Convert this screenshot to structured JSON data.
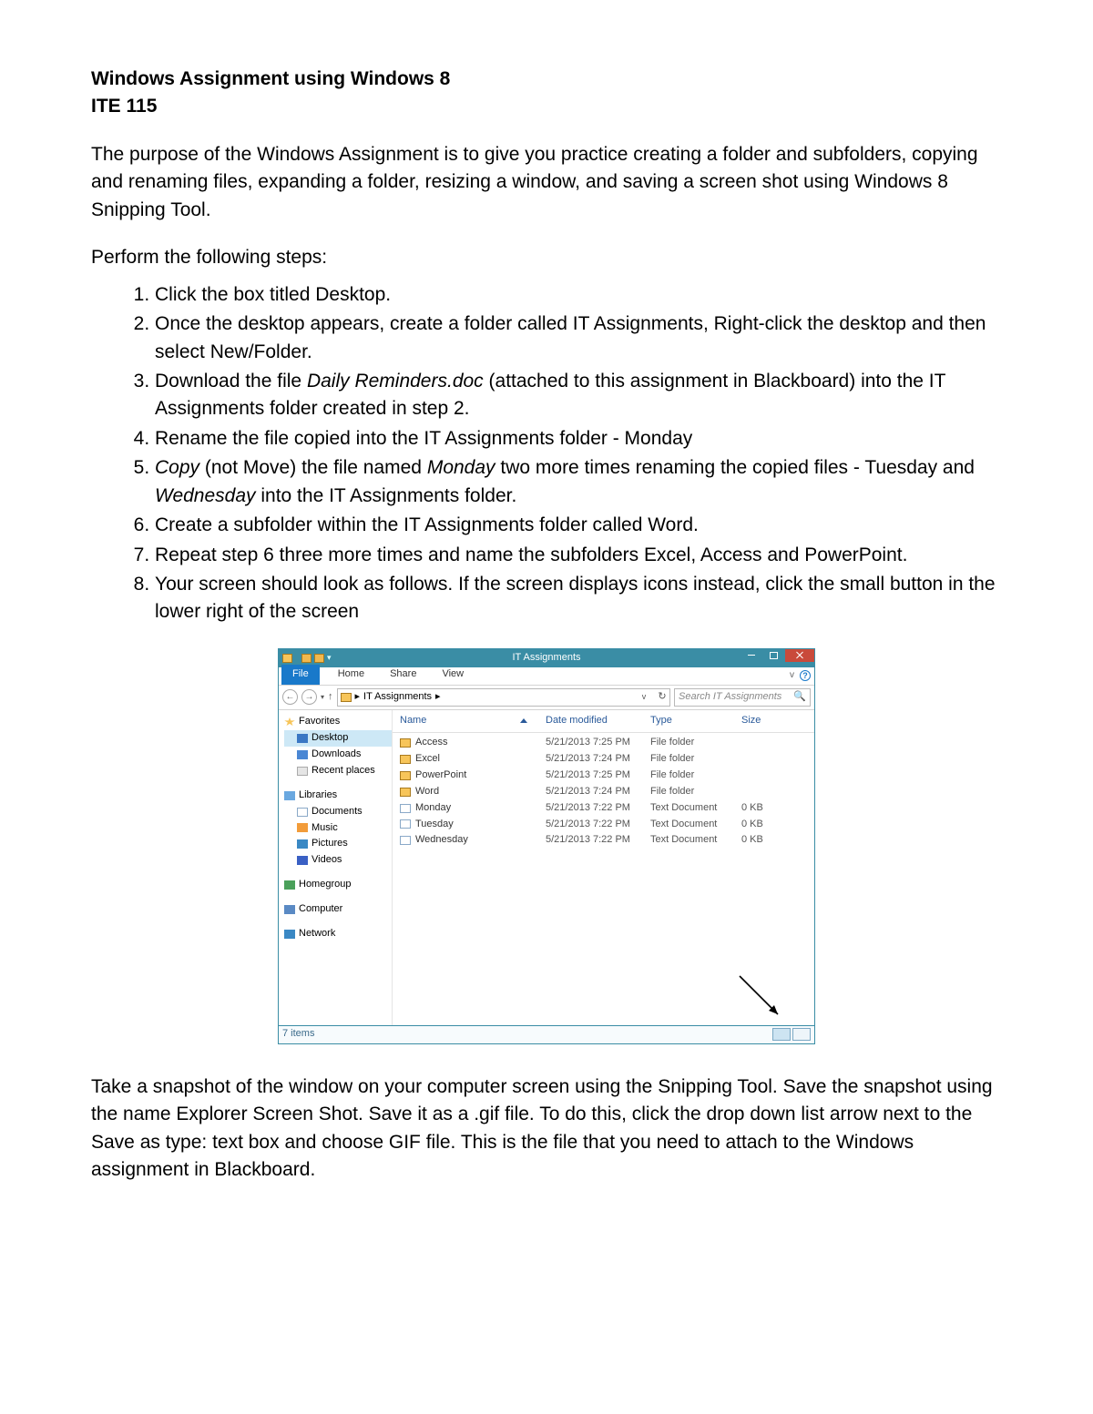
{
  "title1": "Windows Assignment using Windows 8",
  "title2": "ITE 115",
  "intro": "The purpose of the Windows Assignment is to give you practice creating a folder and subfolders, copying and renaming files, expanding a folder, resizing a window, and saving a screen shot using Windows 8 Snipping Tool.",
  "performText": "Perform the following steps:",
  "steps": {
    "s1": "Click the box titled Desktop.",
    "s2": "Once the desktop appears, create a folder called IT Assignments, Right-click the desktop and then select New/Folder.",
    "s3a": "Download the file ",
    "s3file": "Daily Reminders.doc",
    "s3b": " (attached to this assignment in Blackboard) into the IT Assignments folder created in step 2.",
    "s4": "Rename the file copied into the IT Assignments folder - Monday",
    "s5a": "Copy",
    "s5b": " (not Move) the file named ",
    "s5c": "Monday",
    "s5d": " two more times renaming the copied files - Tuesday and ",
    "s5e": "Wednesday",
    "s5f": " into the IT Assignments folder.",
    "s6": "Create a subfolder within the IT Assignments folder called Word.",
    "s7": "Repeat step 6 three more times and name the subfolders Excel, Access and PowerPoint.",
    "s8": "Your screen should look as follows.  If the screen displays icons instead, click the small button in the lower right of the screen"
  },
  "outro": "Take a snapshot of the window on your computer screen using the Snipping Tool.  Save the snapshot using the name Explorer Screen Shot.  Save it as a .gif file.  To do this, click the drop down list arrow next to the Save as type: text box and choose GIF file.  This is the file that you need to attach to the Windows assignment in Blackboard.",
  "explorer": {
    "windowTitle": "IT Assignments",
    "tabs": {
      "file": "File",
      "home": "Home",
      "share": "Share",
      "view": "View"
    },
    "breadcrumb": {
      "arrow1": "▸",
      "folder": "IT Assignments",
      "arrow2": "▸"
    },
    "refreshLabel": "↻",
    "dropdownLabel": "v",
    "searchPlaceholder": "Search IT Assignments",
    "navArrows": {
      "back": "←",
      "fwd": "→",
      "down": "▾",
      "up": "↑"
    },
    "nav": {
      "favorites": "Favorites",
      "desktop": "Desktop",
      "downloads": "Downloads",
      "recent": "Recent places",
      "libraries": "Libraries",
      "documents": "Documents",
      "music": "Music",
      "pictures": "Pictures",
      "videos": "Videos",
      "homegroup": "Homegroup",
      "computer": "Computer",
      "network": "Network"
    },
    "cols": {
      "name": "Name",
      "date": "Date modified",
      "type": "Type",
      "size": "Size"
    },
    "rows": [
      {
        "icon": "fold",
        "name": "Access",
        "date": "5/21/2013 7:25 PM",
        "type": "File folder",
        "size": ""
      },
      {
        "icon": "fold",
        "name": "Excel",
        "date": "5/21/2013 7:24 PM",
        "type": "File folder",
        "size": ""
      },
      {
        "icon": "fold",
        "name": "PowerPoint",
        "date": "5/21/2013 7:25 PM",
        "type": "File folder",
        "size": ""
      },
      {
        "icon": "fold",
        "name": "Word",
        "date": "5/21/2013 7:24 PM",
        "type": "File folder",
        "size": ""
      },
      {
        "icon": "doc",
        "name": "Monday",
        "date": "5/21/2013 7:22 PM",
        "type": "Text Document",
        "size": "0 KB"
      },
      {
        "icon": "doc",
        "name": "Tuesday",
        "date": "5/21/2013 7:22 PM",
        "type": "Text Document",
        "size": "0 KB"
      },
      {
        "icon": "doc",
        "name": "Wednesday",
        "date": "5/21/2013 7:22 PM",
        "type": "Text Document",
        "size": "0 KB"
      }
    ],
    "status": "7 items"
  }
}
